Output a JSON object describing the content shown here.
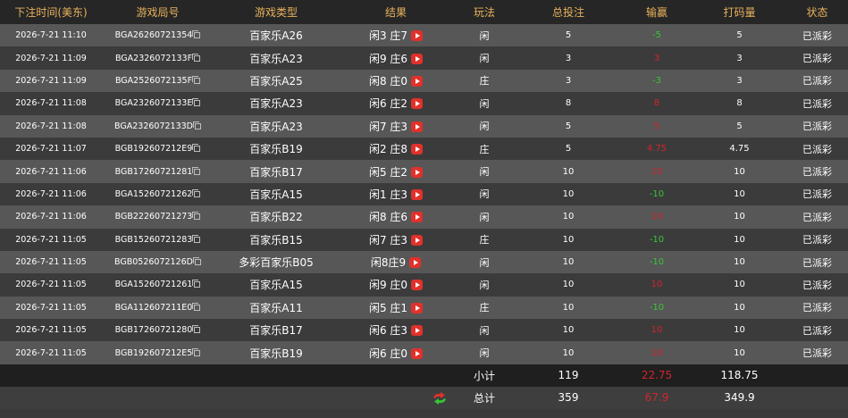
{
  "headers": {
    "time": "下注时间(美东)",
    "round": "游戏局号",
    "game_type": "游戏类型",
    "result": "结果",
    "play": "玩法",
    "total_bet": "总投注",
    "win_loss": "输赢",
    "turnover": "打码量",
    "status": "状态"
  },
  "rows": [
    {
      "time": "2026-7-21 11:10",
      "round": "BGA26260721354",
      "game_type": "百家乐A26",
      "result": "闲3 庄7",
      "play": "闲",
      "total_bet": "5",
      "win_loss": "-5",
      "win_color": "green",
      "turnover": "5",
      "status": "已派彩"
    },
    {
      "time": "2026-7-21 11:09",
      "round": "BGA2326072133F",
      "game_type": "百家乐A23",
      "result": "闲9 庄6",
      "play": "闲",
      "total_bet": "3",
      "win_loss": "3",
      "win_color": "red",
      "turnover": "3",
      "status": "已派彩"
    },
    {
      "time": "2026-7-21 11:09",
      "round": "BGA2526072135F",
      "game_type": "百家乐A25",
      "result": "闲8 庄0",
      "play": "庄",
      "total_bet": "3",
      "win_loss": "-3",
      "win_color": "green",
      "turnover": "3",
      "status": "已派彩"
    },
    {
      "time": "2026-7-21 11:08",
      "round": "BGA2326072133E",
      "game_type": "百家乐A23",
      "result": "闲6 庄2",
      "play": "闲",
      "total_bet": "8",
      "win_loss": "8",
      "win_color": "red",
      "turnover": "8",
      "status": "已派彩"
    },
    {
      "time": "2026-7-21 11:08",
      "round": "BGA2326072133D",
      "game_type": "百家乐A23",
      "result": "闲7 庄3",
      "play": "闲",
      "total_bet": "5",
      "win_loss": "5",
      "win_color": "red",
      "turnover": "5",
      "status": "已派彩"
    },
    {
      "time": "2026-7-21 11:07",
      "round": "BGB192607212E9",
      "game_type": "百家乐B19",
      "result": "闲2 庄8",
      "play": "庄",
      "total_bet": "5",
      "win_loss": "4.75",
      "win_color": "red",
      "turnover": "4.75",
      "status": "已派彩"
    },
    {
      "time": "2026-7-21 11:06",
      "round": "BGB17260721281",
      "game_type": "百家乐B17",
      "result": "闲5 庄2",
      "play": "闲",
      "total_bet": "10",
      "win_loss": "10",
      "win_color": "red",
      "turnover": "10",
      "status": "已派彩"
    },
    {
      "time": "2026-7-21 11:06",
      "round": "BGA15260721262",
      "game_type": "百家乐A15",
      "result": "闲1 庄3",
      "play": "闲",
      "total_bet": "10",
      "win_loss": "-10",
      "win_color": "green",
      "turnover": "10",
      "status": "已派彩"
    },
    {
      "time": "2026-7-21 11:06",
      "round": "BGB22260721273",
      "game_type": "百家乐B22",
      "result": "闲8 庄6",
      "play": "闲",
      "total_bet": "10",
      "win_loss": "10",
      "win_color": "red",
      "turnover": "10",
      "status": "已派彩"
    },
    {
      "time": "2026-7-21 11:05",
      "round": "BGB15260721283",
      "game_type": "百家乐B15",
      "result": "闲7 庄3",
      "play": "庄",
      "total_bet": "10",
      "win_loss": "-10",
      "win_color": "green",
      "turnover": "10",
      "status": "已派彩"
    },
    {
      "time": "2026-7-21 11:05",
      "round": "BGB0526072126D",
      "game_type": "多彩百家乐B05",
      "result": "闲8庄9",
      "play": "闲",
      "total_bet": "10",
      "win_loss": "-10",
      "win_color": "green",
      "turnover": "10",
      "status": "已派彩"
    },
    {
      "time": "2026-7-21 11:05",
      "round": "BGA15260721261",
      "game_type": "百家乐A15",
      "result": "闲9 庄0",
      "play": "闲",
      "total_bet": "10",
      "win_loss": "10",
      "win_color": "red",
      "turnover": "10",
      "status": "已派彩"
    },
    {
      "time": "2026-7-21 11:05",
      "round": "BGA112607211E0",
      "game_type": "百家乐A11",
      "result": "闲5 庄1",
      "play": "庄",
      "total_bet": "10",
      "win_loss": "-10",
      "win_color": "green",
      "turnover": "10",
      "status": "已派彩"
    },
    {
      "time": "2026-7-21 11:05",
      "round": "BGB17260721280",
      "game_type": "百家乐B17",
      "result": "闲6 庄3",
      "play": "闲",
      "total_bet": "10",
      "win_loss": "10",
      "win_color": "red",
      "turnover": "10",
      "status": "已派彩"
    },
    {
      "time": "2026-7-21 11:05",
      "round": "BGB192607212E5",
      "game_type": "百家乐B19",
      "result": "闲6 庄0",
      "play": "闲",
      "total_bet": "10",
      "win_loss": "10",
      "win_color": "red",
      "turnover": "10",
      "status": "已派彩"
    }
  ],
  "subtotal": {
    "label": "小计",
    "total_bet": "119",
    "win_loss": "22.75",
    "turnover": "118.75"
  },
  "total": {
    "label": "总计",
    "total_bet": "359",
    "win_loss": "67.9",
    "turnover": "349.9"
  },
  "colors": {
    "header_text": "#e8b15c",
    "win_green": "#35c637",
    "loss_red": "#d2242c",
    "play_button": "#e0312b"
  },
  "icons": {
    "copy": "copy-icon",
    "play": "play-icon",
    "refresh": "refresh-icon"
  }
}
